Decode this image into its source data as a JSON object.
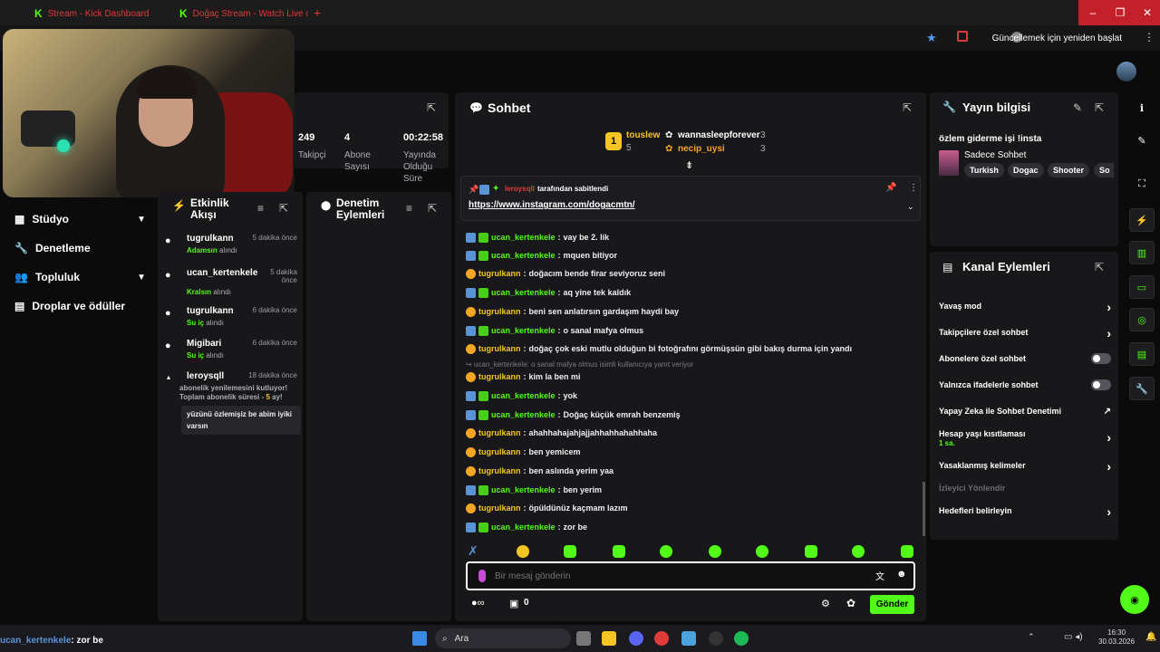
{
  "browser": {
    "tabs": [
      {
        "title": "Stream - Kick Dashboard"
      },
      {
        "title": "Doğaç Stream - Watch Live on"
      }
    ],
    "update_button": "Güncellemek için yeniden başlat"
  },
  "stats": {
    "followers_value": "249",
    "followers_label": "Takipçi",
    "subs_value": "4",
    "subs_label": "Abone Sayısı",
    "uptime_value": "00:22:58",
    "uptime_label": "Yayında Olduğu Süre"
  },
  "nav": [
    {
      "label": "Stüdyo"
    },
    {
      "label": "Denetleme"
    },
    {
      "label": "Topluluk"
    },
    {
      "label": "Droplar ve ödüller"
    }
  ],
  "activity": {
    "title": "Etkinlik Akışı",
    "items": [
      {
        "name": "tugrulkann",
        "time": "5 dakika önce",
        "item": "Adamsın",
        "suffix": "alındı"
      },
      {
        "name": "ucan_kertenkele",
        "time": "5 dakika önce",
        "item": "Kralsın",
        "suffix": "alındı"
      },
      {
        "name": "tugrulkann",
        "time": "6 dakika önce",
        "item": "Su iç",
        "suffix": "alındı"
      },
      {
        "name": "Migibari",
        "time": "6 dakika önce",
        "item": "Su iç",
        "suffix": "alındı"
      },
      {
        "name": "leroysqll",
        "time": "18 dakika önce",
        "line1": "abonelik yenilemesini kutluyor!",
        "line2": "Toplam abonelik süresi -",
        "months": "5",
        "months_suffix": "ay!",
        "message": "yüzünü özlemişiz be abim iyiki varsın"
      }
    ]
  },
  "moderation": {
    "title": "Denetim Eylemleri"
  },
  "chat": {
    "title": "Sohbet",
    "gifters": [
      {
        "name": "touslew",
        "count": "5"
      },
      {
        "name": "wannasleepforever",
        "count": "3"
      },
      {
        "name": "necip_uysi",
        "count": "3"
      }
    ],
    "pinned": {
      "user": "leroysqll",
      "by_text": "tarafından sabitlendi",
      "link": "https://www.instagram.com/dogacmtn/"
    },
    "messages": [
      {
        "user": "ucan_kertenkele",
        "type": "mod",
        "text": "vay be 2. lik"
      },
      {
        "user": "ucan_kertenkele",
        "type": "mod",
        "text": "mquen bitiyor"
      },
      {
        "user": "tugrulkann",
        "type": "sub",
        "text": "doğacım bende firar seviyoruz seni"
      },
      {
        "user": "ucan_kertenkele",
        "type": "mod",
        "text": "aq yine tek kaldık"
      },
      {
        "user": "tugrulkann",
        "type": "sub",
        "text": "beni sen anlatırsın gardaşım haydi bay"
      },
      {
        "user": "ucan_kertenkele",
        "type": "mod",
        "text": "o sanal mafya olmus"
      },
      {
        "user": "tugrulkann",
        "type": "sub",
        "text": "doğaç çok eski mutlu olduğun bi fotoğrafını görmüşsün gibi bakış durma için yandı"
      },
      {
        "user": "tugrulkann",
        "type": "sub",
        "text": "kim la ben mi"
      },
      {
        "user": "ucan_kertenkele",
        "type": "mod",
        "text": "yok"
      },
      {
        "user": "ucan_kertenkele",
        "type": "mod",
        "text": "Doğaç küçük emrah benzemiş"
      },
      {
        "user": "tugrulkann",
        "type": "sub",
        "text": "ahahhahajahjajjahhahhahahhaha"
      },
      {
        "user": "tugrulkann",
        "type": "sub",
        "text": "ben yemicem"
      },
      {
        "user": "tugrulkann",
        "type": "sub",
        "text": "ben aslında yerim yaa"
      },
      {
        "user": "ucan_kertenkele",
        "type": "mod",
        "text": "ben yerim"
      },
      {
        "user": "tugrulkann",
        "type": "sub",
        "text": "öpüldünüz kaçmam lazım"
      },
      {
        "user": "ucan_kertenkele",
        "type": "mod",
        "text": "zor be"
      }
    ],
    "reply_hint": "ucan_kertenkele: o sanal mafya olmus isimli kullanıcıya yanıt veriyor",
    "input_placeholder": "Bir mesaj gönderin",
    "points": "0",
    "send_label": "Gönder"
  },
  "stream_info": {
    "title": "Yayın bilgisi",
    "stream_title": "özlem giderme işi !insta",
    "category": "Sadece Sohbet",
    "tags": [
      "Turkish",
      "Dogac",
      "Shooter",
      "So"
    ]
  },
  "channel_actions": {
    "title": "Kanal Eylemleri",
    "items": [
      {
        "label": "Yavaş mod"
      },
      {
        "label": "Takipçilere özel sohbet"
      },
      {
        "label": "Abonelere özel sohbet"
      },
      {
        "label": "Yalnızca ifadelerle sohbet"
      },
      {
        "label": "Yapay Zeka ile Sohbet Denetimi"
      },
      {
        "label": "Hesap yaşı kısıtlaması",
        "sub": "1 sa."
      },
      {
        "label": "Yasaklanmış kelimeler"
      },
      {
        "label": "İzleyici Yönlendir"
      },
      {
        "label": "Hedefleri belirleyin"
      }
    ]
  },
  "bottom_overlay": {
    "user": "ucan_kertenkele",
    "text": ": zor be"
  },
  "taskbar": {
    "search": "Ara",
    "time": "16:30",
    "date": "30.03.2026"
  }
}
